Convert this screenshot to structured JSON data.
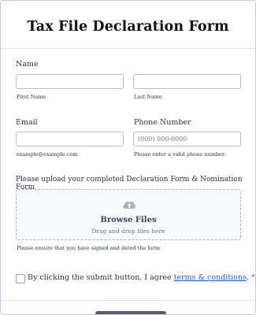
{
  "form": {
    "title": "Tax File Declaration Form",
    "name": {
      "label": "Name",
      "first_value": "",
      "first_sublabel": "First Name",
      "last_value": "",
      "last_sublabel": "Last Name"
    },
    "email": {
      "label": "Email",
      "value": "",
      "sublabel": "example@example.com"
    },
    "phone": {
      "label": "Phone Number",
      "placeholder": "(000) 000-0000",
      "sublabel": "Please enter a valid phone number."
    },
    "upload": {
      "label": "Please upload your completed Declaration Form & Nomination Form",
      "icon": "cloud-upload-icon",
      "browse_label": "Browse Files",
      "drag_text": "Drag and drop files here",
      "sublabel": "Please ensure that you have signed and dated the form"
    },
    "agreement": {
      "text": "By clicking the submit button, I agree ",
      "link_text": "terms & conditions",
      "suffix": ".",
      "required_mark": "*",
      "checked": false
    }
  },
  "colors": {
    "link": "#2b55d4",
    "required": "#e33333",
    "submit_button": "#5a5f6b"
  }
}
